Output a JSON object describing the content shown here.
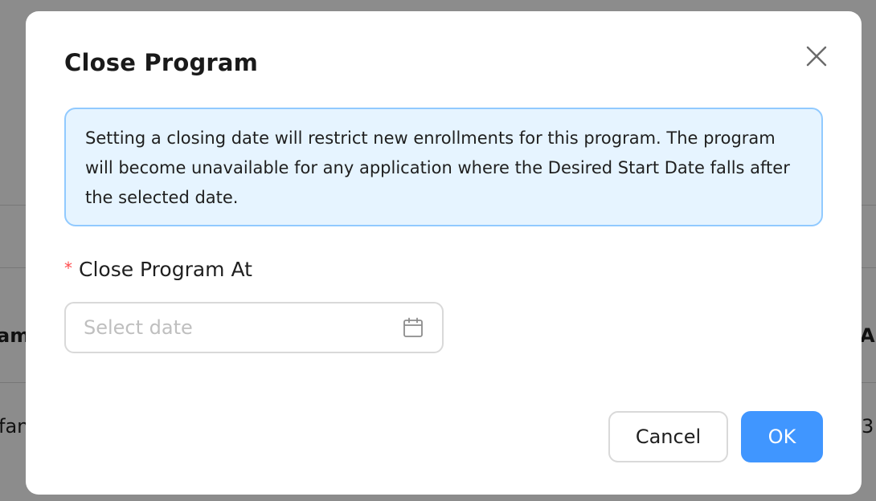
{
  "background": {
    "fragments": {
      "left_header": "am",
      "left_row": "fan",
      "right_header": "A",
      "right_row": "3"
    }
  },
  "modal": {
    "title": "Close Program",
    "close_icon": "close-icon",
    "info_text": "Setting a closing date will restrict new enrollments for this program. The program will become unavailable for any application where the Desired Start Date falls after the selected date.",
    "field": {
      "required_marker": "*",
      "label": "Close Program At",
      "placeholder": "Select date",
      "value": "",
      "icon": "calendar-icon"
    },
    "buttons": {
      "cancel_label": "Cancel",
      "ok_label": "OK"
    }
  },
  "colors": {
    "primary": "#4096ff",
    "info_bg": "#e6f4ff",
    "info_border": "#91caff",
    "required": "#ff4d4f",
    "overlay": "rgba(0,0,0,0.45)"
  }
}
